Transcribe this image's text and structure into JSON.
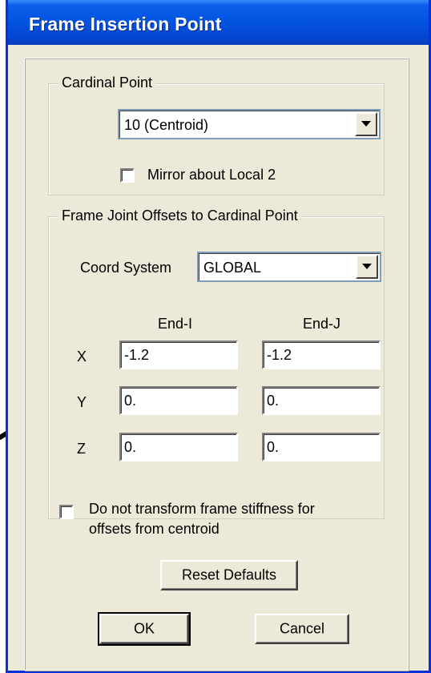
{
  "window": {
    "title": "Frame Insertion Point"
  },
  "cardinal_point": {
    "group_label": "Cardinal Point",
    "selected": "10 (Centroid)",
    "mirror_label": "Mirror about Local 2",
    "mirror_checked": false
  },
  "offsets": {
    "group_label": "Frame Joint Offsets to Cardinal Point",
    "coord_label": "Coord System",
    "coord_selected": "GLOBAL",
    "col_i": "End-I",
    "col_j": "End-J",
    "rows": [
      {
        "axis": "X",
        "end_i": "-1.2",
        "end_j": "-1.2"
      },
      {
        "axis": "Y",
        "end_i": "0.",
        "end_j": "0."
      },
      {
        "axis": "Z",
        "end_i": "0.",
        "end_j": "0."
      }
    ]
  },
  "stiffness": {
    "line1": "Do not transform frame stiffness for",
    "line2": "offsets from centroid",
    "checked": false
  },
  "buttons": {
    "reset": "Reset Defaults",
    "ok": "OK",
    "cancel": "Cancel"
  }
}
